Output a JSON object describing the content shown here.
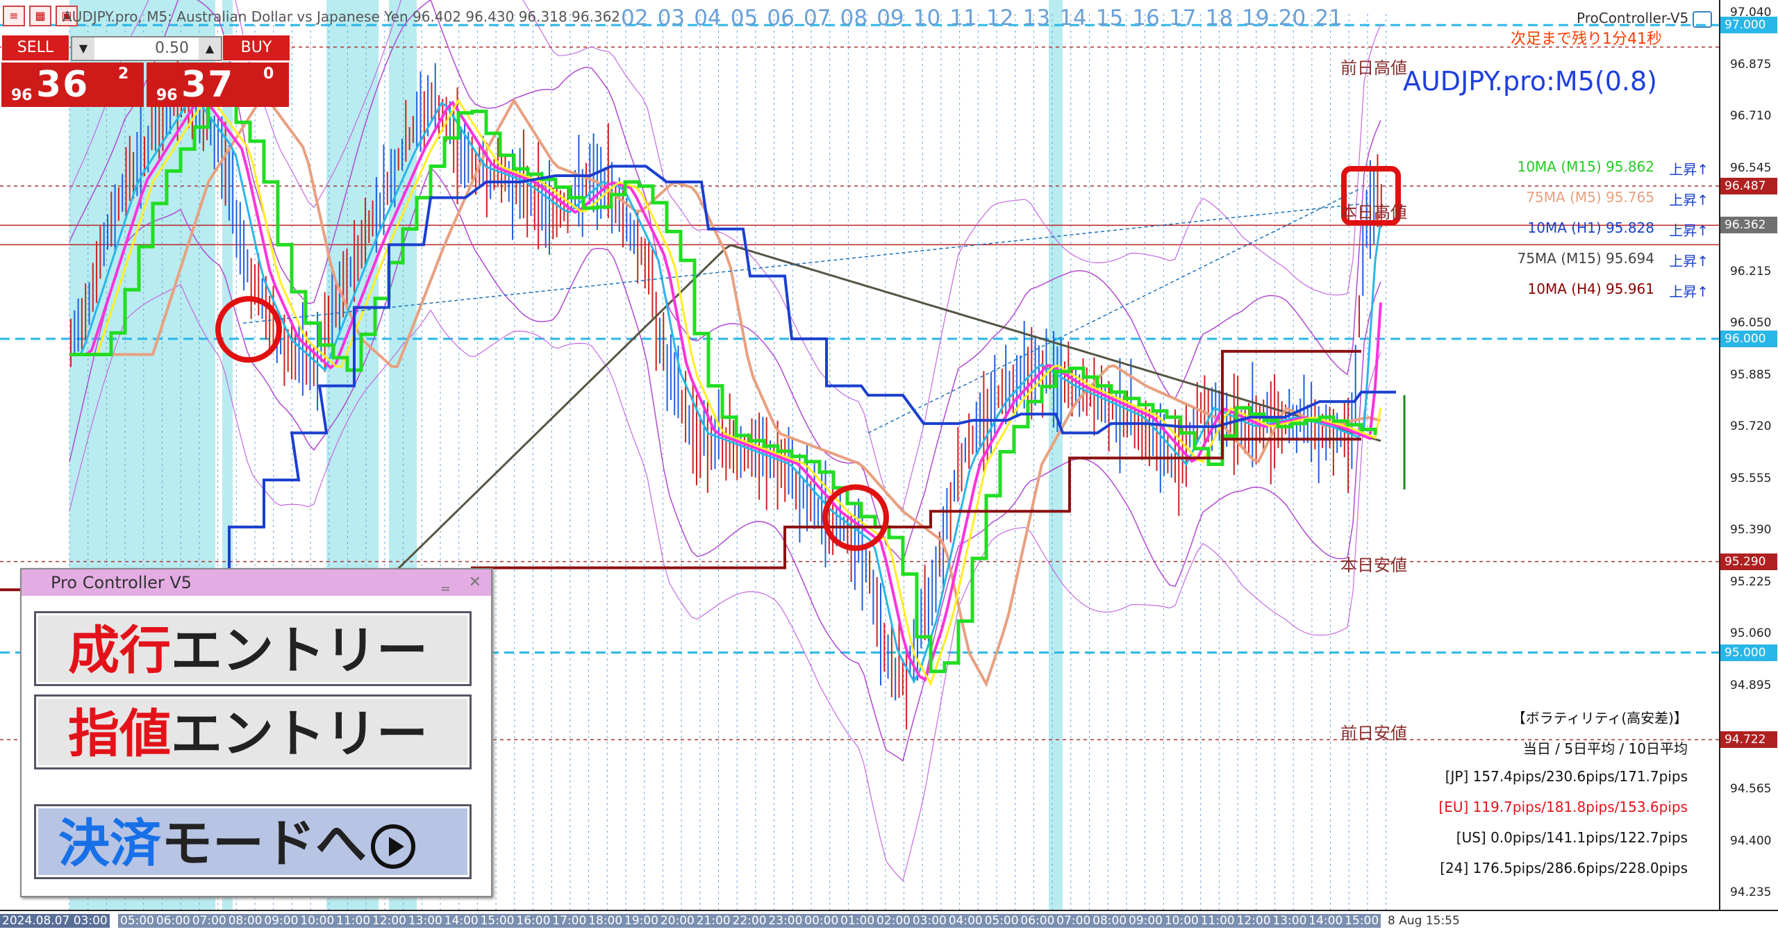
{
  "window": {
    "title": "AUDJPY.pro, M5: Australian Dollar vs Japanese Yen  96.402 96.430 96.318 96.362",
    "toolbar_icons": [
      "list-icon",
      "chart-icon",
      "lock-icon"
    ]
  },
  "date_numbers": [
    "02",
    "03",
    "04",
    "05",
    "06",
    "07",
    "08",
    "09",
    "10",
    "11",
    "12",
    "13",
    "14",
    "15",
    "16",
    "17",
    "18",
    "19",
    "20",
    "21"
  ],
  "indicator": {
    "name": "ProController-V5",
    "countdown": "次足まで残り1分41秒",
    "symbol_label": "AUDJPY.pro:M5(0.8)"
  },
  "labels": {
    "prev_high": "前日高値",
    "today_high": "本日高値",
    "today_low": "本日安値",
    "prev_low": "前日安値"
  },
  "trade_panel": {
    "sell_label": "SELL",
    "buy_label": "BUY",
    "lot": "0.50",
    "bid_prefix": "96",
    "bid_big": "36",
    "bid_sup": "2",
    "ask_prefix": "96",
    "ask_big": "37",
    "ask_sup": "0"
  },
  "pro_controller": {
    "title": "Pro Controller V5",
    "market_entry_accent": "成行",
    "market_entry_rest": "エントリー",
    "limit_entry_accent": "指値",
    "limit_entry_rest": "エントリー",
    "exit_mode_accent": "決済",
    "exit_mode_rest": "モードへ"
  },
  "ma_panel": [
    {
      "name": "10MA (M15) 95.862",
      "trend": "上昇↑",
      "color": "#22cc22"
    },
    {
      "name": "75MA (M5)  95.765",
      "trend": "上昇↑",
      "color": "#e8a080"
    },
    {
      "name": "10MA (H1)  95.828",
      "trend": "上昇↑",
      "color": "#1a3fcf"
    },
    {
      "name": "75MA (M15) 95.694",
      "trend": "上昇↑",
      "color": "#444444"
    },
    {
      "name": "10MA (H4)  95.961",
      "trend": "上昇↑",
      "color": "#8b0000"
    }
  ],
  "volatility": {
    "title": "【ボラティリティ(高安差)】",
    "subtitle": "当日 / 5日平均 / 10日平均",
    "rows": [
      {
        "text": "[JP] 157.4pips/230.6pips/171.7pips",
        "color": "#111111"
      },
      {
        "text": "[EU] 119.7pips/181.8pips/153.6pips",
        "color": "#e3121a"
      },
      {
        "text": "[US]   0.0pips/141.1pips/122.7pips",
        "color": "#111111"
      },
      {
        "text": "[24] 176.5pips/286.6pips/228.0pips",
        "color": "#111111"
      }
    ]
  },
  "price_axis": {
    "ticks": [
      {
        "label": "97.040",
        "p": 97.04
      },
      {
        "label": "96.875",
        "p": 96.875
      },
      {
        "label": "96.710",
        "p": 96.71
      },
      {
        "label": "96.545",
        "p": 96.545
      },
      {
        "label": "96.215",
        "p": 96.215
      },
      {
        "label": "96.050",
        "p": 96.05
      },
      {
        "label": "95.885",
        "p": 95.885
      },
      {
        "label": "95.720",
        "p": 95.72
      },
      {
        "label": "95.555",
        "p": 95.555
      },
      {
        "label": "95.390",
        "p": 95.39
      },
      {
        "label": "95.225",
        "p": 95.225
      },
      {
        "label": "95.060",
        "p": 95.06
      },
      {
        "label": "94.895",
        "p": 94.895
      },
      {
        "label": "94.565",
        "p": 94.565
      },
      {
        "label": "94.400",
        "p": 94.4
      },
      {
        "label": "94.235",
        "p": 94.235
      }
    ],
    "tags": [
      {
        "label": "97.000",
        "p": 97.0,
        "color": "#29b6e8"
      },
      {
        "label": "96.487",
        "p": 96.487,
        "color": "#b02020"
      },
      {
        "label": "96.362",
        "p": 96.362,
        "color": "#707070"
      },
      {
        "label": "96.000",
        "p": 96.0,
        "color": "#29b6e8"
      },
      {
        "label": "95.290",
        "p": 95.29,
        "color": "#b02020"
      },
      {
        "label": "95.000",
        "p": 95.0,
        "color": "#29b6e8"
      },
      {
        "label": "94.722",
        "p": 94.722,
        "color": "#b02020"
      }
    ]
  },
  "time_axis": {
    "labels": [
      "2024.08.07 03:00",
      "05:00",
      "06:00",
      "07:00",
      "08:00",
      "09:00",
      "10:00",
      "11:00",
      "12:00",
      "13:00",
      "14:00",
      "15:00",
      "16:00",
      "17:00",
      "18:00",
      "19:00",
      "20:00",
      "21:00",
      "22:00",
      "23:00",
      "00:00",
      "01:00",
      "02:00",
      "03:00",
      "04:00",
      "05:00",
      "06:00",
      "07:00",
      "08:00",
      "09:00",
      "10:00",
      "11:00",
      "12:00",
      "13:00",
      "14:00",
      "15:00"
    ],
    "current": "8 Aug 15:55"
  }
}
